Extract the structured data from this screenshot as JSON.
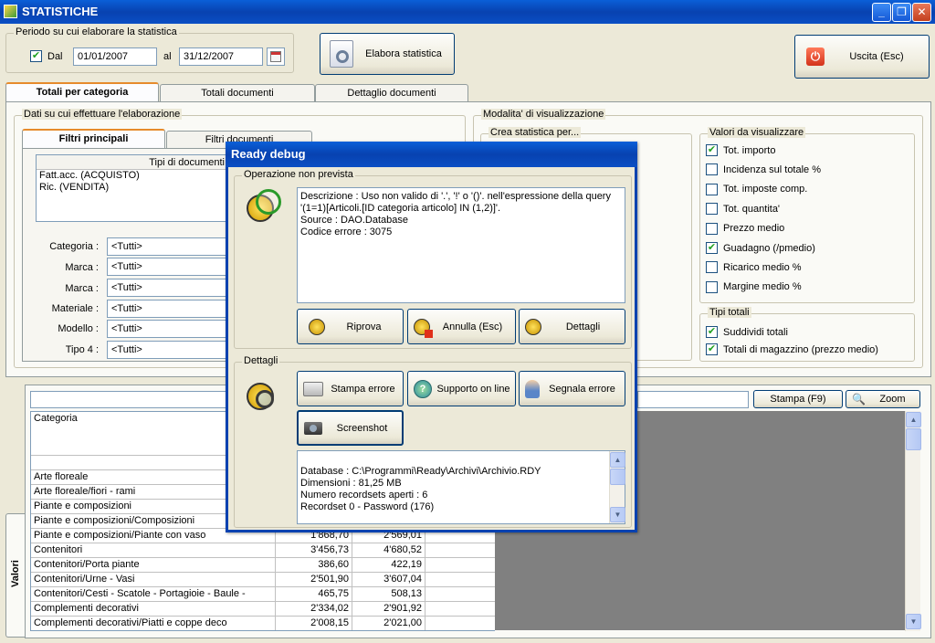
{
  "window": {
    "title": "STATISTICHE",
    "buttons": {
      "minimize": "_",
      "restore": "❐",
      "close": "✕"
    }
  },
  "period": {
    "group_label": "Periodo su cui elaborare la statistica",
    "dal_label": "Dal",
    "dal_checked": true,
    "from": "01/01/2007",
    "al_label": "al",
    "to": "31/12/2007",
    "calendar_icon": "calendar-icon"
  },
  "elabora_button": "Elabora statistica",
  "exit_button": "Uscita (Esc)",
  "main_tabs": [
    "Totali per categoria",
    "Totali documenti",
    "Dettaglio documenti"
  ],
  "data_group": {
    "label": "Dati su cui effettuare l'elaborazione",
    "tabs": [
      "Filtri principali",
      "Filtri documenti"
    ],
    "doc_types_header": "Tipi di documenti",
    "doc_types": [
      "Fatt.acc. (ACQUISTO)",
      "Ric. (VENDITA)"
    ],
    "filters": [
      {
        "label": "Categoria :",
        "value": "<Tutti>"
      },
      {
        "label": "Marca :",
        "value": "<Tutti>"
      },
      {
        "label": "Marca :",
        "value": "<Tutti>"
      },
      {
        "label": "Materiale :",
        "value": "<Tutti>"
      },
      {
        "label": "Modello :",
        "value": "<Tutti>"
      },
      {
        "label": "Tipo 4 :",
        "value": "<Tutti>"
      }
    ]
  },
  "view_mode": {
    "label": "Modalita' di visualizzazione",
    "create_label": "Crea statistica per...",
    "values_label": "Valori da visualizzare",
    "values": [
      {
        "label": "Tot. importo",
        "checked": true
      },
      {
        "label": "Incidenza sul totale %",
        "checked": false
      },
      {
        "label": "Tot. imposte comp.",
        "checked": false
      },
      {
        "label": "Tot. quantita'",
        "checked": false
      },
      {
        "label": "Prezzo medio",
        "checked": false
      },
      {
        "label": "Guadagno (/pmedio)",
        "checked": true
      },
      {
        "label": "Ricarico medio %",
        "checked": false
      },
      {
        "label": "Margine medio %",
        "checked": false
      }
    ],
    "totals_label": "Tipi totali",
    "totals": [
      {
        "label": "Suddividi totali",
        "checked": true
      },
      {
        "label": "Totali di magazzino (prezzo medio)",
        "checked": true
      }
    ]
  },
  "results": {
    "side_tab": "Valori",
    "print_button": "Stampa (F9)",
    "zoom_button": "Zoom",
    "header": "Categoria",
    "rows": [
      {
        "cat": "Arte floreale",
        "v1": "",
        "v2": ""
      },
      {
        "cat": "Arte floreale/fiori - rami",
        "v1": "",
        "v2": ""
      },
      {
        "cat": "Piante e composizioni",
        "v1": "",
        "v2": ""
      },
      {
        "cat": "Piante e composizioni/Composizioni",
        "v1": "",
        "v2": ""
      },
      {
        "cat": "Piante e composizioni/Piante con vaso",
        "v1": "1'868,70",
        "v2": "2'569,01"
      },
      {
        "cat": "Contenitori",
        "v1": "3'456,73",
        "v2": "4'680,52"
      },
      {
        "cat": "Contenitori/Porta piante",
        "v1": "386,60",
        "v2": "422,19"
      },
      {
        "cat": "Contenitori/Urne - Vasi",
        "v1": "2'501,90",
        "v2": "3'607,04"
      },
      {
        "cat": "Contenitori/Cesti - Scatole - Portagioie - Baule -",
        "v1": "465,75",
        "v2": "508,13"
      },
      {
        "cat": "Complementi decorativi",
        "v1": "2'334,02",
        "v2": "2'901,92"
      },
      {
        "cat": "Complementi decorativi/Piatti e coppe deco",
        "v1": "2'008,15",
        "v2": "2'021,00"
      }
    ]
  },
  "dialog": {
    "title": "Ready debug",
    "op_group": "Operazione non prevista",
    "message": "Descrizione : Uso non valido di '.', '!' o '()'. nell'espressione della query '(1=1)[Articoli.[ID categoria articolo] IN (1,2)]'.\nSource : DAO.Database\nCodice errore : 3075",
    "buttons": [
      "Riprova",
      "Annulla (Esc)",
      "Dettagli"
    ],
    "details_group": "Dettagli",
    "detail_buttons": [
      "Stampa errore",
      "Supporto on line",
      "Segnala errore",
      "Screenshot"
    ],
    "details_text": "\nDatabase : C:\\Programmi\\Ready\\Archivi\\Archivio.RDY\nDimensioni : 81,25 MB\nNumero recordsets aperti : 6\nRecordset 0 - Password (176)"
  }
}
